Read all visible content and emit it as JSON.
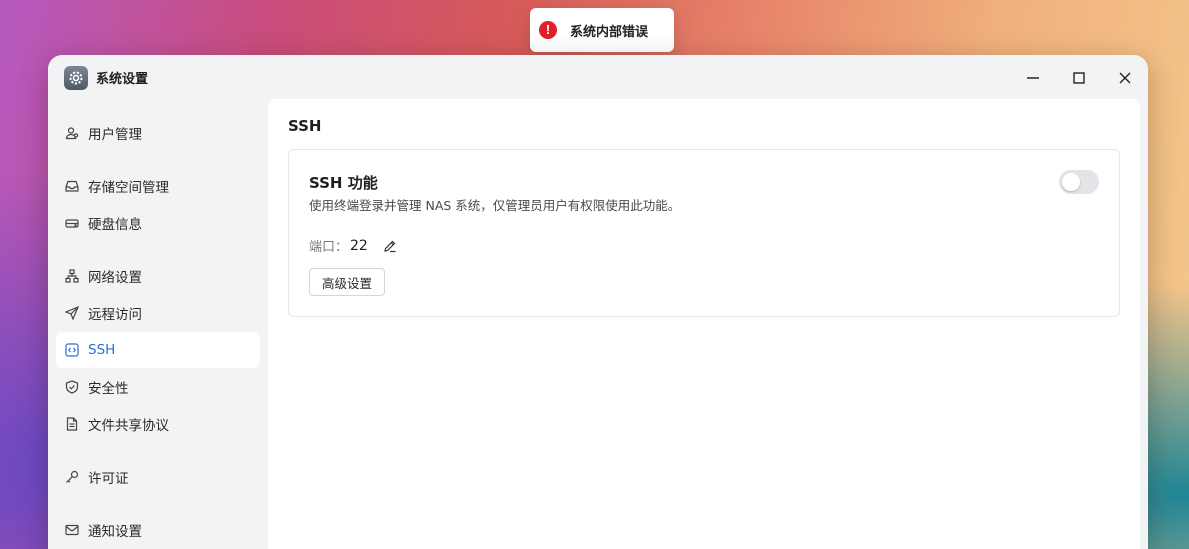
{
  "toast": {
    "icon": "error-icon",
    "message": "系统内部错误",
    "color": "#e0202a"
  },
  "window": {
    "title": "系统设置",
    "app_icon": "gear-icon",
    "controls": [
      "minimize-icon",
      "maximize-icon",
      "close-icon"
    ]
  },
  "sidebar": {
    "items": [
      {
        "label": "用户管理",
        "icon": "users-icon"
      },
      {
        "label": "存储空间管理",
        "icon": "inbox-icon"
      },
      {
        "label": "硬盘信息",
        "icon": "disk-icon"
      },
      {
        "label": "网络设置",
        "icon": "network-icon"
      },
      {
        "label": "远程访问",
        "icon": "send-icon"
      },
      {
        "label": "SSH",
        "icon": "code-icon",
        "active": true
      },
      {
        "label": "安全性",
        "icon": "shield-icon"
      },
      {
        "label": "文件共享协议",
        "icon": "file-icon"
      },
      {
        "label": "许可证",
        "icon": "key-icon"
      },
      {
        "label": "通知设置",
        "icon": "mail-icon"
      }
    ]
  },
  "main": {
    "title": "SSH",
    "card": {
      "title": "SSH 功能",
      "description": "使用终端登录并管理 NAS 系统，仅管理员用户有权限使用此功能。",
      "toggle_on": false,
      "port_label": "端口：",
      "port_value": "22",
      "advanced_button": "高级设置"
    }
  },
  "accent_color": "#2f6fd6"
}
